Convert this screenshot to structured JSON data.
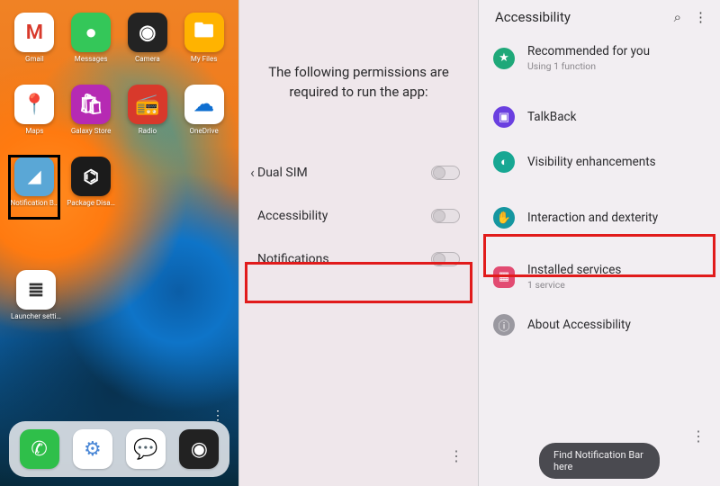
{
  "panel1": {
    "apps": [
      {
        "name": "gmail",
        "label": "Gmail",
        "glyph": "M"
      },
      {
        "name": "messages",
        "label": "Messages",
        "glyph": "●"
      },
      {
        "name": "camera",
        "label": "Camera",
        "glyph": "◉"
      },
      {
        "name": "myfiles",
        "label": "My Files",
        "glyph": "🖿"
      },
      {
        "name": "maps",
        "label": "Maps",
        "glyph": "📍"
      },
      {
        "name": "galaxystore",
        "label": "Galaxy Store",
        "glyph": "🛍"
      },
      {
        "name": "radio",
        "label": "Radio",
        "glyph": "📻"
      },
      {
        "name": "onedrive",
        "label": "OneDrive",
        "glyph": "☁"
      },
      {
        "name": "notebar",
        "label": "Notification B…",
        "glyph": "◢"
      },
      {
        "name": "pkg",
        "label": "Package Disa…",
        "glyph": "⌬"
      }
    ],
    "launcher": {
      "label": "Launcher setti…",
      "glyph": "≣"
    },
    "dock": [
      {
        "name": "phone",
        "glyph": "✆"
      },
      {
        "name": "settings",
        "glyph": "⚙"
      },
      {
        "name": "chat",
        "glyph": "💬"
      },
      {
        "name": "cam",
        "glyph": "◉"
      }
    ]
  },
  "panel2": {
    "title": "The following permissions are required to run the app:",
    "back": "‹",
    "perms": [
      {
        "label": "Dual SIM"
      },
      {
        "label": "Accessibility"
      },
      {
        "label": "Notifications"
      }
    ],
    "highlighted_index": 1
  },
  "panel3": {
    "header": "Accessibility",
    "rows": [
      {
        "icon": "rec",
        "label": "Recommended for you",
        "sub": "Using 1 function"
      },
      {
        "icon": "talk",
        "label": "TalkBack"
      },
      {
        "icon": "vis",
        "label": "Visibility enhancements"
      },
      {
        "icon": "inter",
        "label": "Interaction and dexterity"
      },
      {
        "icon": "inst",
        "label": "Installed services",
        "sub": "1 service"
      },
      {
        "icon": "about",
        "label": "About Accessibility"
      }
    ],
    "highlighted_index": 4,
    "toast": "Find Notification Bar here"
  }
}
